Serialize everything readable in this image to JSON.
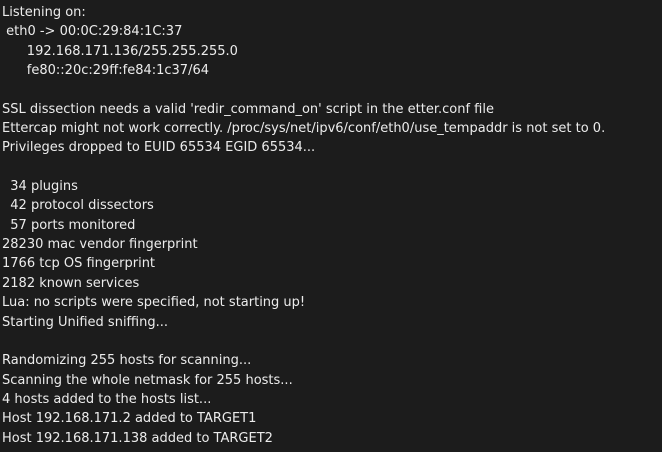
{
  "terminal": {
    "lines": [
      "Listening on:",
      " eth0 -> 00:0C:29:84:1C:37",
      "      192.168.171.136/255.255.255.0",
      "      fe80::20c:29ff:fe84:1c37/64",
      "",
      "SSL dissection needs a valid 'redir_command_on' script in the etter.conf file",
      "Ettercap might not work correctly. /proc/sys/net/ipv6/conf/eth0/use_tempaddr is not set to 0.",
      "Privileges dropped to EUID 65534 EGID 65534...",
      "",
      "  34 plugins",
      "  42 protocol dissectors",
      "  57 ports monitored",
      "28230 mac vendor fingerprint",
      "1766 tcp OS fingerprint",
      "2182 known services",
      "Lua: no scripts were specified, not starting up!",
      "Starting Unified sniffing...",
      "",
      "Randomizing 255 hosts for scanning...",
      "Scanning the whole netmask for 255 hosts...",
      "4 hosts added to the hosts list...",
      "Host 192.168.171.2 added to TARGET1",
      "Host 192.168.171.138 added to TARGET2"
    ]
  }
}
